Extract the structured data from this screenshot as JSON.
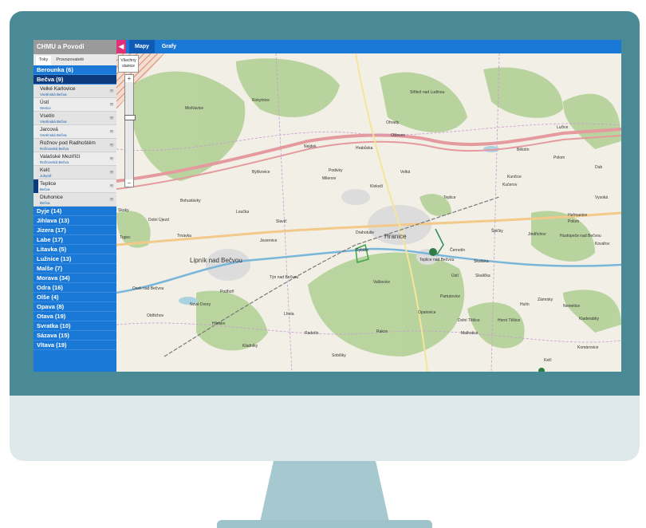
{
  "sidebar": {
    "header": "CHMU a Povodi",
    "tabs": [
      "Toky",
      "Provozovatelé"
    ],
    "rivers_before": [
      "Berounka (6)"
    ],
    "open_river": "Bečva (9)",
    "stations": [
      {
        "name": "Velké Karlovice",
        "river": "Vsetínská Bečva"
      },
      {
        "name": "Ústí",
        "river": "Senice"
      },
      {
        "name": "Vsetín",
        "river": "Vsetínská Bečva"
      },
      {
        "name": "Jarcová",
        "river": "Vsetínská Bečva"
      },
      {
        "name": "Rožnov pod Radhoštěm",
        "river": "Rožnovská Bečva"
      },
      {
        "name": "Valašské Meziříčí",
        "river": "Rožnovská Bečva"
      },
      {
        "name": "Kelč",
        "river": "Juhyně"
      },
      {
        "name": "Teplice",
        "river": "Bečva"
      },
      {
        "name": "Dluhonice",
        "river": "Bečva"
      }
    ],
    "rivers_after": [
      "Dyje (14)",
      "Jihlava (13)",
      "Jizera (17)",
      "Labe (17)",
      "Litavka (5)",
      "Lužnice (13)",
      "Malše (7)",
      "Morava (34)",
      "Odra (16)",
      "Olše (4)",
      "Opava (8)",
      "Otava (19)",
      "Svratka (10)",
      "Sázava (15)",
      "Vltava (19)"
    ]
  },
  "topbar": {
    "collapse_icon": "◀",
    "tabs": [
      "Mapy",
      "Grafy"
    ]
  },
  "map_controls": {
    "all_stations": "Všechny stanice",
    "zoom_in": "+",
    "zoom_out": "−"
  },
  "map_labels": [
    "Lipník nad Bečvou",
    "Hranice",
    "Drahotuše",
    "Teplice nad Bečvou",
    "Černotín",
    "Kunčice",
    "Špičky",
    "Hustopeče nad Bečvou",
    "Skalička",
    "Bělotín",
    "Polom",
    "Střítež nad Ludinou",
    "Jezernice",
    "Týn nad Bečvou",
    "Osek nad Bečvou",
    "Nové Dvory",
    "Podhoří",
    "Slavíč",
    "Valšovice",
    "Opatovice",
    "Ústí",
    "Zámrsky",
    "Rakov",
    "Horní Těšice",
    "Kladerubky",
    "Lučice",
    "Nejdek",
    "Olšovec",
    "Milenov",
    "Ohrady",
    "Kelč",
    "Býškovice",
    "Podivky",
    "Teplice",
    "Loučka",
    "Tupec",
    "Dolní Újezd",
    "Skoky",
    "Trnávka",
    "Dolní Těšice",
    "Komárovice",
    "Hrabůvka",
    "Velká",
    "Klokočí",
    "Rybáře",
    "Partutovice",
    "Kučerov",
    "Nemetice",
    "Dub",
    "Hulín",
    "Hlinsko",
    "Radotín",
    "Sobíšky",
    "Kladníky",
    "Lhota",
    "Oldřichov",
    "Malhotice",
    "Skaliska",
    "Jindřichov",
    "Polom",
    "Bohuslávky",
    "Rokytnice",
    "Kovářov",
    "Heřmanice",
    "Vysoká",
    "Mošťavice"
  ],
  "colors": {
    "sidebar": "#1a78d6",
    "open_river": "#0d3a7a",
    "collapse": "#e0307a",
    "frame": "#4a8a96"
  }
}
